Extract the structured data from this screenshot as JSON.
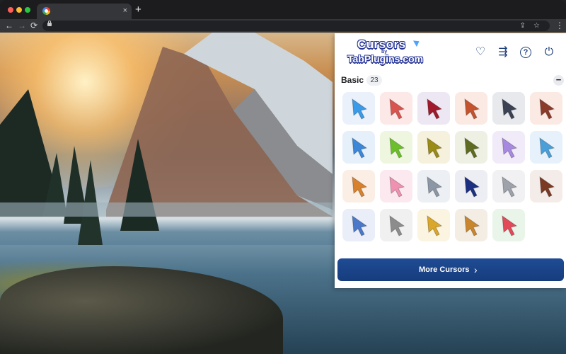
{
  "browser": {
    "tab": {
      "close_glyph": "×"
    },
    "new_tab_glyph": "+",
    "nav": {
      "back": "←",
      "forward": "→",
      "reload": "⟳"
    },
    "omnibox": {
      "share_glyph": "⇪",
      "star_glyph": "☆"
    },
    "menu_glyph": "⋮"
  },
  "popup": {
    "logo": {
      "top": "Cursors",
      "by": "by",
      "bottom": "TabPlugins.com"
    },
    "header_icons": {
      "heart": "♡",
      "share": "⇶",
      "help": "?",
      "power": "⏻"
    },
    "section": {
      "title": "Basic",
      "count": "23",
      "collapse_glyph": "−"
    },
    "cursors": [
      {
        "name": "pointer-plus",
        "bg": "#eaf1fb",
        "color": "#3a9be8"
      },
      {
        "name": "stop-sign",
        "bg": "#fde8e8",
        "color": "#d9534f"
      },
      {
        "name": "red-ball-arrow",
        "bg": "#ede7f3",
        "color": "#a01a2b"
      },
      {
        "name": "orange-arrow",
        "bg": "#fbe9e3",
        "color": "#c4532e"
      },
      {
        "name": "circle-button",
        "bg": "#e8e9ed",
        "color": "#3b4254"
      },
      {
        "name": "boot",
        "bg": "#fbe9e3",
        "color": "#8a3b2a"
      },
      {
        "name": "blue-arrow",
        "bg": "#e6f0fb",
        "color": "#3d87d8"
      },
      {
        "name": "green-sun",
        "bg": "#eef6e0",
        "color": "#6bbf2a"
      },
      {
        "name": "olive-arrow",
        "bg": "#f5f1dc",
        "color": "#9a8a16"
      },
      {
        "name": "leaf-arrow",
        "bg": "#eef0e4",
        "color": "#5f6b22"
      },
      {
        "name": "lavender-arrow",
        "bg": "#f1eaf8",
        "color": "#a78ae0"
      },
      {
        "name": "rocket",
        "bg": "#e6f1fb",
        "color": "#4a9fd8"
      },
      {
        "name": "whisk",
        "bg": "#fbeee4",
        "color": "#d8822e"
      },
      {
        "name": "pink-hand",
        "bg": "#fbe9ef",
        "color": "#f091b2"
      },
      {
        "name": "silver-arrow",
        "bg": "#eceff3",
        "color": "#8c97a6"
      },
      {
        "name": "navy-yellow-arrow",
        "bg": "#eceef3",
        "color": "#1c2f80"
      },
      {
        "name": "grey-arrow",
        "bg": "#f1f1f3",
        "color": "#9ea2ab"
      },
      {
        "name": "brown-arrow",
        "bg": "#f4ece8",
        "color": "#7a3a24"
      },
      {
        "name": "solar-panel",
        "bg": "#e9eef8",
        "color": "#4b78c9"
      },
      {
        "name": "ruler",
        "bg": "#f0f0f0",
        "color": "#8c8c8c"
      },
      {
        "name": "trophy",
        "bg": "#fbf4e0",
        "color": "#d9a72a"
      },
      {
        "name": "cassette",
        "bg": "#f4ede4",
        "color": "#c9862d"
      },
      {
        "name": "watermelon",
        "bg": "#eaf5ea",
        "color": "#e24a5a"
      }
    ],
    "more_button": {
      "label": "More Cursors",
      "arrow": "›"
    }
  }
}
